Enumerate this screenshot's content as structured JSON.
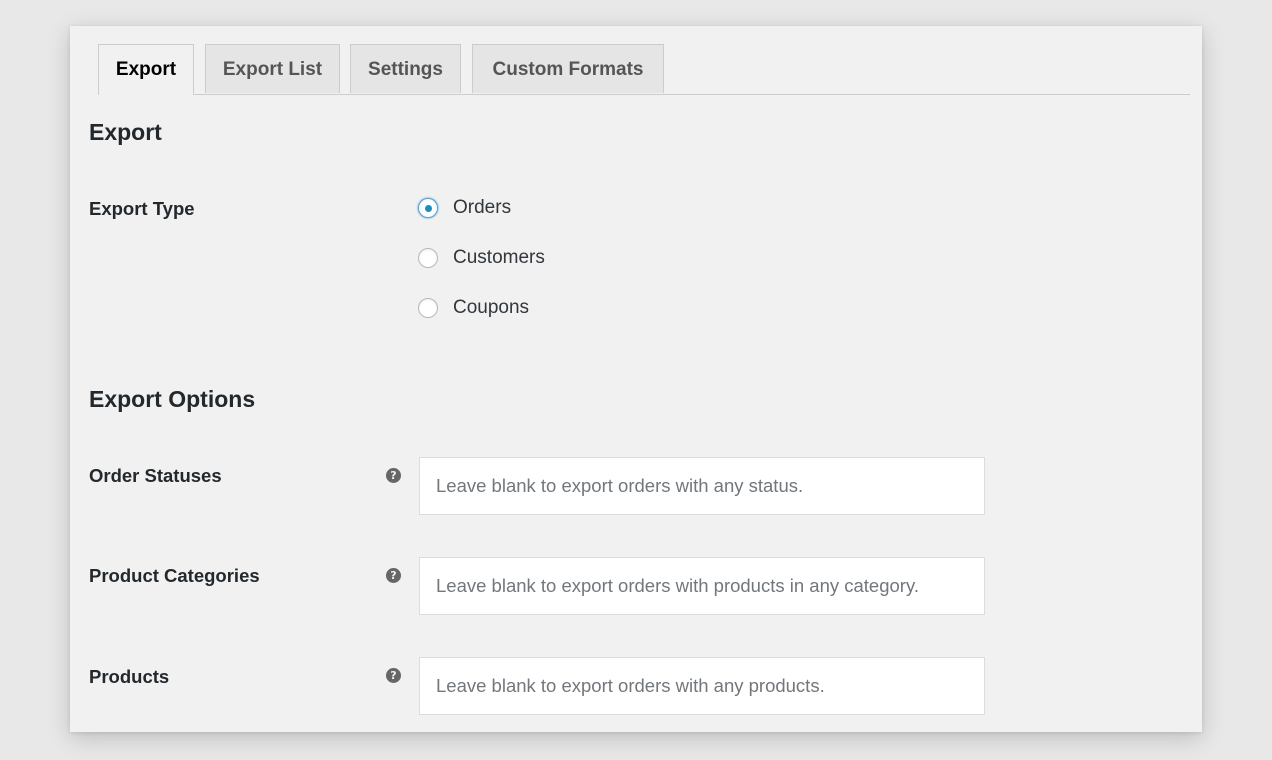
{
  "tabs": [
    {
      "label": "Export",
      "active": true
    },
    {
      "label": "Export List",
      "active": false
    },
    {
      "label": "Settings",
      "active": false
    },
    {
      "label": "Custom Formats",
      "active": false
    }
  ],
  "export_section": {
    "title": "Export",
    "export_type": {
      "label": "Export Type",
      "selected": "Orders",
      "options": [
        "Orders",
        "Customers",
        "Coupons"
      ]
    }
  },
  "options_section": {
    "title": "Export Options",
    "fields": [
      {
        "label": "Order Statuses",
        "value": "",
        "placeholder": "Leave blank to export orders with any status."
      },
      {
        "label": "Product Categories",
        "value": "",
        "placeholder": "Leave blank to export orders with products in any category."
      },
      {
        "label": "Products",
        "value": "",
        "placeholder": "Leave blank to export orders with any products."
      }
    ]
  },
  "icons": {
    "help": "help-icon",
    "help_glyph": "?"
  },
  "colors": {
    "accent": "#1e8cbe",
    "panel_bg": "#f1f1f1",
    "page_bg": "#e8e8e8"
  }
}
